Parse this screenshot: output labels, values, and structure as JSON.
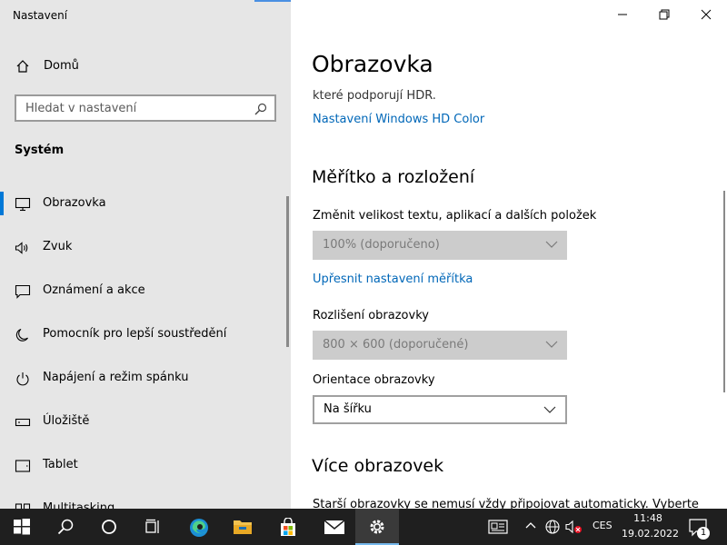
{
  "window": {
    "app_title": "Nastavení",
    "controls": {
      "minimize": "minimize",
      "maximize": "maximize",
      "close": "close"
    }
  },
  "sidebar": {
    "home_label": "Domů",
    "search_placeholder": "Hledat v nastavení",
    "section": "Systém",
    "items": [
      {
        "label": "Obrazovka",
        "icon": "monitor-icon",
        "active": true
      },
      {
        "label": "Zvuk",
        "icon": "speaker-icon"
      },
      {
        "label": "Oznámení a akce",
        "icon": "message-icon"
      },
      {
        "label": "Pomocník pro lepší soustředění",
        "icon": "moon-icon"
      },
      {
        "label": "Napájení a režim spánku",
        "icon": "power-icon"
      },
      {
        "label": "Úložiště",
        "icon": "storage-icon"
      },
      {
        "label": "Tablet",
        "icon": "tablet-icon"
      },
      {
        "label": "Multitasking",
        "icon": "multitasking-icon"
      }
    ]
  },
  "main": {
    "title": "Obrazovka",
    "hdr_text": "které podporují HDR.",
    "hdr_link": "Nastavení Windows HD Color",
    "scale_heading": "Měřítko a rozložení",
    "scale_label": "Změnit velikost textu, aplikací a dalších položek",
    "scale_value": "100% (doporučeno)",
    "advanced_scale_link": "Upřesnit nastavení měřítka",
    "resolution_label": "Rozlišení obrazovky",
    "resolution_value": "800 × 600 (doporučené)",
    "orientation_label": "Orientace obrazovky",
    "orientation_value": "Na šířku",
    "multi_heading": "Více obrazovek",
    "multi_text": "Starší obrazovky se nemusí vždy připojovat automaticky. Vyberte"
  },
  "taskbar": {
    "apps": [
      "start",
      "search",
      "cortana",
      "task-view",
      "edge",
      "file-explorer",
      "store",
      "mail",
      "settings"
    ],
    "language": "CES",
    "time": "11:48",
    "date": "19.02.2022",
    "notification_count": "1"
  },
  "colors": {
    "accent": "#0078d7",
    "link": "#0067b8",
    "sidebar_bg": "#e6e6e6",
    "taskbar_bg": "#1f1f1f"
  }
}
